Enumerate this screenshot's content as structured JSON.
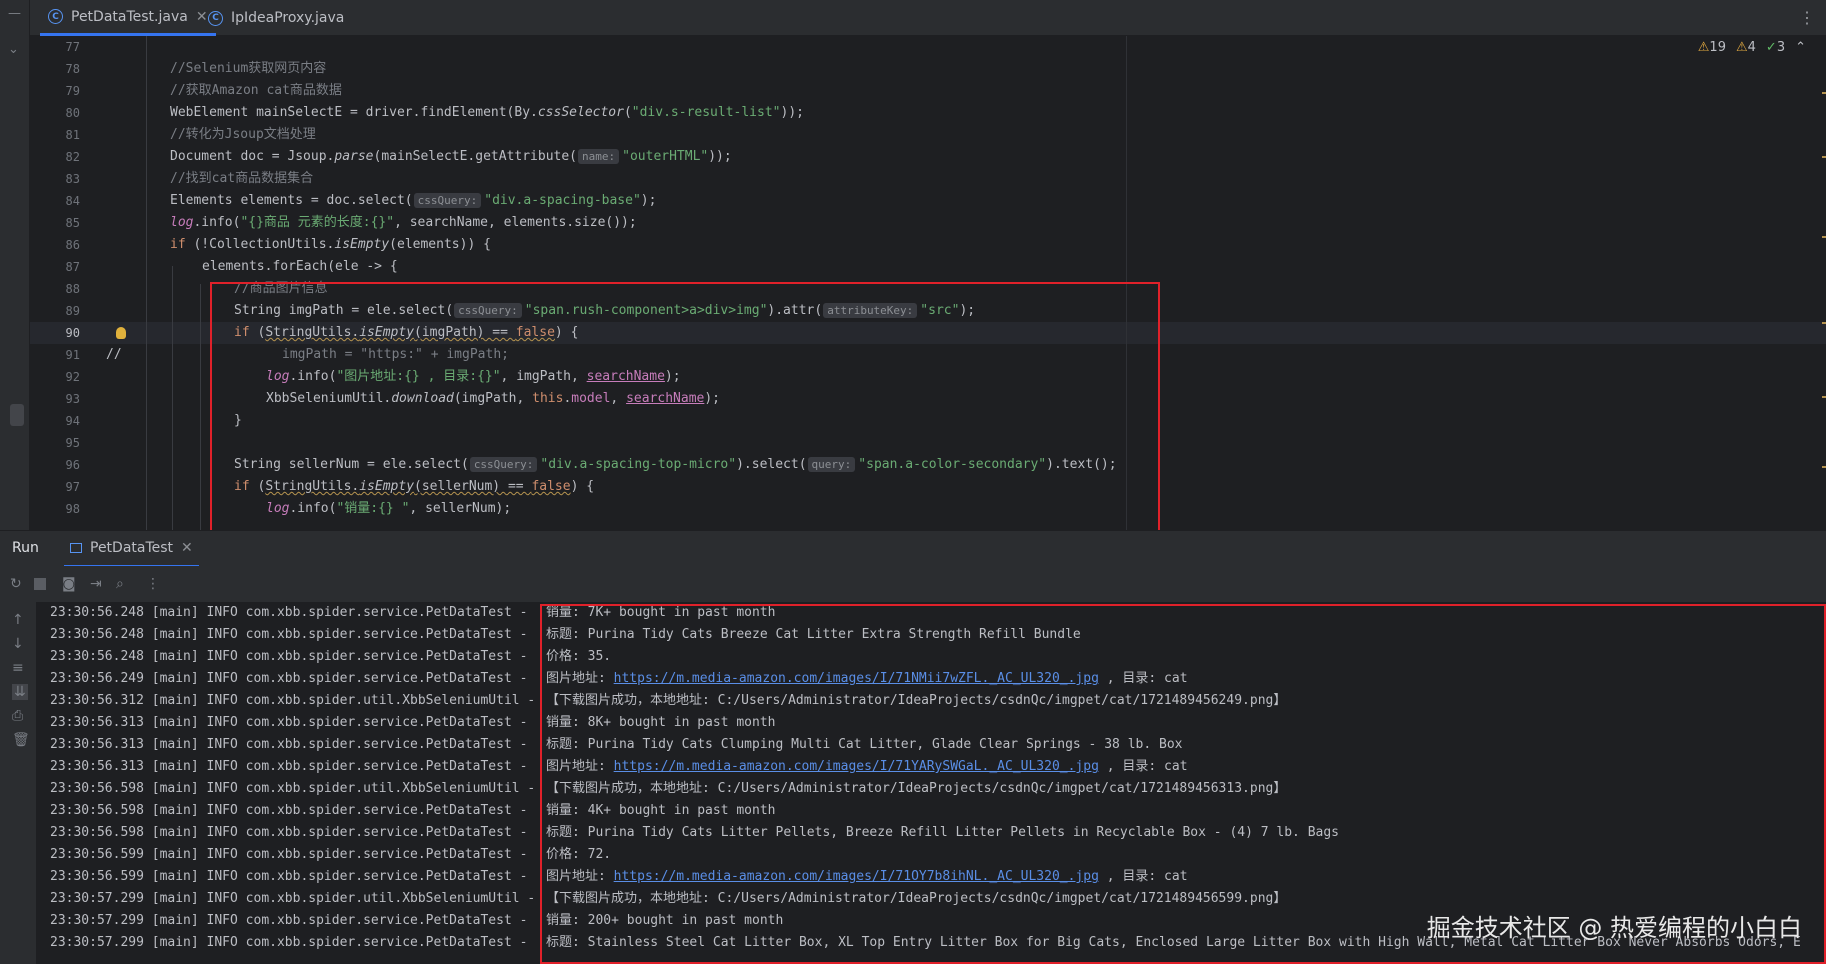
{
  "tabs": [
    {
      "label": "PetDataTest.java",
      "icon": "java-class-icon",
      "active": true
    },
    {
      "label": "IpIdeaProxy.java",
      "icon": "java-class-icon",
      "active": false
    }
  ],
  "inspections": {
    "warnings": "19",
    "weak_warnings": "4",
    "ok": "3"
  },
  "editor": {
    "line_numbers": [
      "77",
      "78",
      "79",
      "80",
      "81",
      "82",
      "83",
      "84",
      "85",
      "86",
      "87",
      "88",
      "89",
      "90",
      "91",
      "92",
      "93",
      "94",
      "95",
      "96",
      "97",
      "98"
    ],
    "current_line": "90",
    "comment_marker": "//",
    "lines": {
      "l78": "//Selenium获取网页内容",
      "l79": "//获取Amazon cat商品数据",
      "l80a": "WebElement mainSelectE = driver.findElement(By.",
      "l80b": "cssSelector",
      "l80c": "(",
      "l80d": "\"div.s-result-list\"",
      "l80e": "));",
      "l81": "//转化为Jsoup文档处理",
      "l82a": "Document doc = Jsoup.",
      "l82b": "parse",
      "l82c": "(mainSelectE.getAttribute(",
      "l82h": "name:",
      "l82d": "\"outerHTML\"",
      "l82e": "));",
      "l83": "//找到cat商品数据集合",
      "l84a": "Elements elements = doc.select(",
      "l84h": "cssQuery:",
      "l84d": "\"div.a-spacing-base\"",
      "l84e": ");",
      "l85a": "log",
      "l85b": ".info(",
      "l85d": "\"{}商品 元素的长度:{}\"",
      "l85e": ", searchName, elements.size());",
      "l86a": "if",
      "l86b": " (!CollectionUtils.",
      "l86c": "isEmpty",
      "l86d": "(elements)) {",
      "l87": "elements.forEach(ele -> {",
      "l88": "//商品图片信息",
      "l89a": "String imgPath = ele.select(",
      "l89h": "cssQuery:",
      "l89d": "\"span.rush-component>a>div>img\"",
      "l89e": ").attr(",
      "l89h2": "attributeKey:",
      "l89f": "\"src\"",
      "l89g": ");",
      "l90a": "if",
      "l90b": " (",
      "l90c": "StringUtils.",
      "l90d": "isEmpty",
      "l90e": "(imgPath) == ",
      "l90f": "false",
      "l90g": ") {",
      "l91": "imgPath = \"https:\" + imgPath;",
      "l92a": "log",
      "l92b": ".info(",
      "l92d": "\"图片地址:{} , 目录:{}\"",
      "l92e": ", imgPath, ",
      "l92f": "searchName",
      "l92g": ");",
      "l93a": "XbbSeleniumUtil.",
      "l93b": "download",
      "l93c": "(imgPath, ",
      "l93d": "this",
      "l93e": ".",
      "l93f": "model",
      "l93g": ", ",
      "l93h": "searchName",
      "l93i": ");",
      "l94": "}",
      "l96a": "String sellerNum = ele.select(",
      "l96h": "cssQuery:",
      "l96d": "\"div.a-spacing-top-micro\"",
      "l96e": ").select(",
      "l96h2": "query:",
      "l96f": "\"span.a-color-secondary\"",
      "l96g": ").text();",
      "l97a": "if",
      "l97b": " (",
      "l97c": "StringUtils.",
      "l97d": "isEmpty",
      "l97e": "(sellerNum) == ",
      "l97f": "false",
      "l97g": ") {",
      "l98a": "log",
      "l98b": ".info(",
      "l98d": "\"销量:{} \"",
      "l98e": ", sellerNum);"
    }
  },
  "run": {
    "label": "Run",
    "tab": "PetDataTest",
    "log": [
      {
        "prefix": "23:30:56.248 [main] INFO com.xbb.spider.service.PetDataTest -",
        "msg": "销量: 7K+ bought in past month"
      },
      {
        "prefix": "23:30:56.248 [main] INFO com.xbb.spider.service.PetDataTest -",
        "msg": "标题: Purina Tidy Cats Breeze Cat Litter Extra Strength Refill Bundle"
      },
      {
        "prefix": "23:30:56.248 [main] INFO com.xbb.spider.service.PetDataTest -",
        "msg": "价格: 35."
      },
      {
        "prefix": "23:30:56.249 [main] INFO com.xbb.spider.service.PetDataTest -",
        "msg": "图片地址: ",
        "link": "https://m.media-amazon.com/images/I/71NMii7wZFL._AC_UL320_.jpg",
        "tail": " , 目录: cat"
      },
      {
        "prefix": "23:30:56.312 [main] INFO com.xbb.spider.util.XbbSeleniumUtil -",
        "msg": "【下载图片成功，本地地址: C:/Users/Administrator/IdeaProjects/csdnQc/imgpet/cat/1721489456249.png】"
      },
      {
        "prefix": "23:30:56.313 [main] INFO com.xbb.spider.service.PetDataTest -",
        "msg": "销量: 8K+ bought in past month"
      },
      {
        "prefix": "23:30:56.313 [main] INFO com.xbb.spider.service.PetDataTest -",
        "msg": "标题: Purina Tidy Cats Clumping Multi Cat Litter, Glade Clear Springs - 38 lb. Box"
      },
      {
        "prefix": "23:30:56.313 [main] INFO com.xbb.spider.service.PetDataTest -",
        "msg": "图片地址: ",
        "link": "https://m.media-amazon.com/images/I/71YARySWGaL._AC_UL320_.jpg",
        "tail": " , 目录: cat"
      },
      {
        "prefix": "23:30:56.598 [main] INFO com.xbb.spider.util.XbbSeleniumUtil -",
        "msg": "【下载图片成功，本地地址: C:/Users/Administrator/IdeaProjects/csdnQc/imgpet/cat/1721489456313.png】"
      },
      {
        "prefix": "23:30:56.598 [main] INFO com.xbb.spider.service.PetDataTest -",
        "msg": "销量: 4K+ bought in past month"
      },
      {
        "prefix": "23:30:56.598 [main] INFO com.xbb.spider.service.PetDataTest -",
        "msg": "标题: Purina Tidy Cats Litter Pellets, Breeze Refill Litter Pellets in Recyclable Box - (4) 7 lb. Bags"
      },
      {
        "prefix": "23:30:56.599 [main] INFO com.xbb.spider.service.PetDataTest -",
        "msg": "价格: 72."
      },
      {
        "prefix": "23:30:56.599 [main] INFO com.xbb.spider.service.PetDataTest -",
        "msg": "图片地址: ",
        "link": "https://m.media-amazon.com/images/I/71OY7b8ihNL._AC_UL320_.jpg",
        "tail": " , 目录: cat"
      },
      {
        "prefix": "23:30:57.299 [main] INFO com.xbb.spider.util.XbbSeleniumUtil -",
        "msg": "【下载图片成功，本地地址: C:/Users/Administrator/IdeaProjects/csdnQc/imgpet/cat/1721489456599.png】"
      },
      {
        "prefix": "23:30:57.299 [main] INFO com.xbb.spider.service.PetDataTest -",
        "msg": "销量: 200+ bought in past month"
      },
      {
        "prefix": "23:30:57.299 [main] INFO com.xbb.spider.service.PetDataTest -",
        "msg": "标题: Stainless Steel Cat Litter Box, XL Top Entry Litter Box for Big Cats, Enclosed Large Litter Box with High Wall, Metal Cat Litter Box Never Absorbs Odors, E"
      }
    ]
  },
  "watermark": "掘金技术社区 @ 热爱编程的小白白",
  "colors": {
    "highlight_box": "#e0212a",
    "accent": "#3574f0"
  }
}
